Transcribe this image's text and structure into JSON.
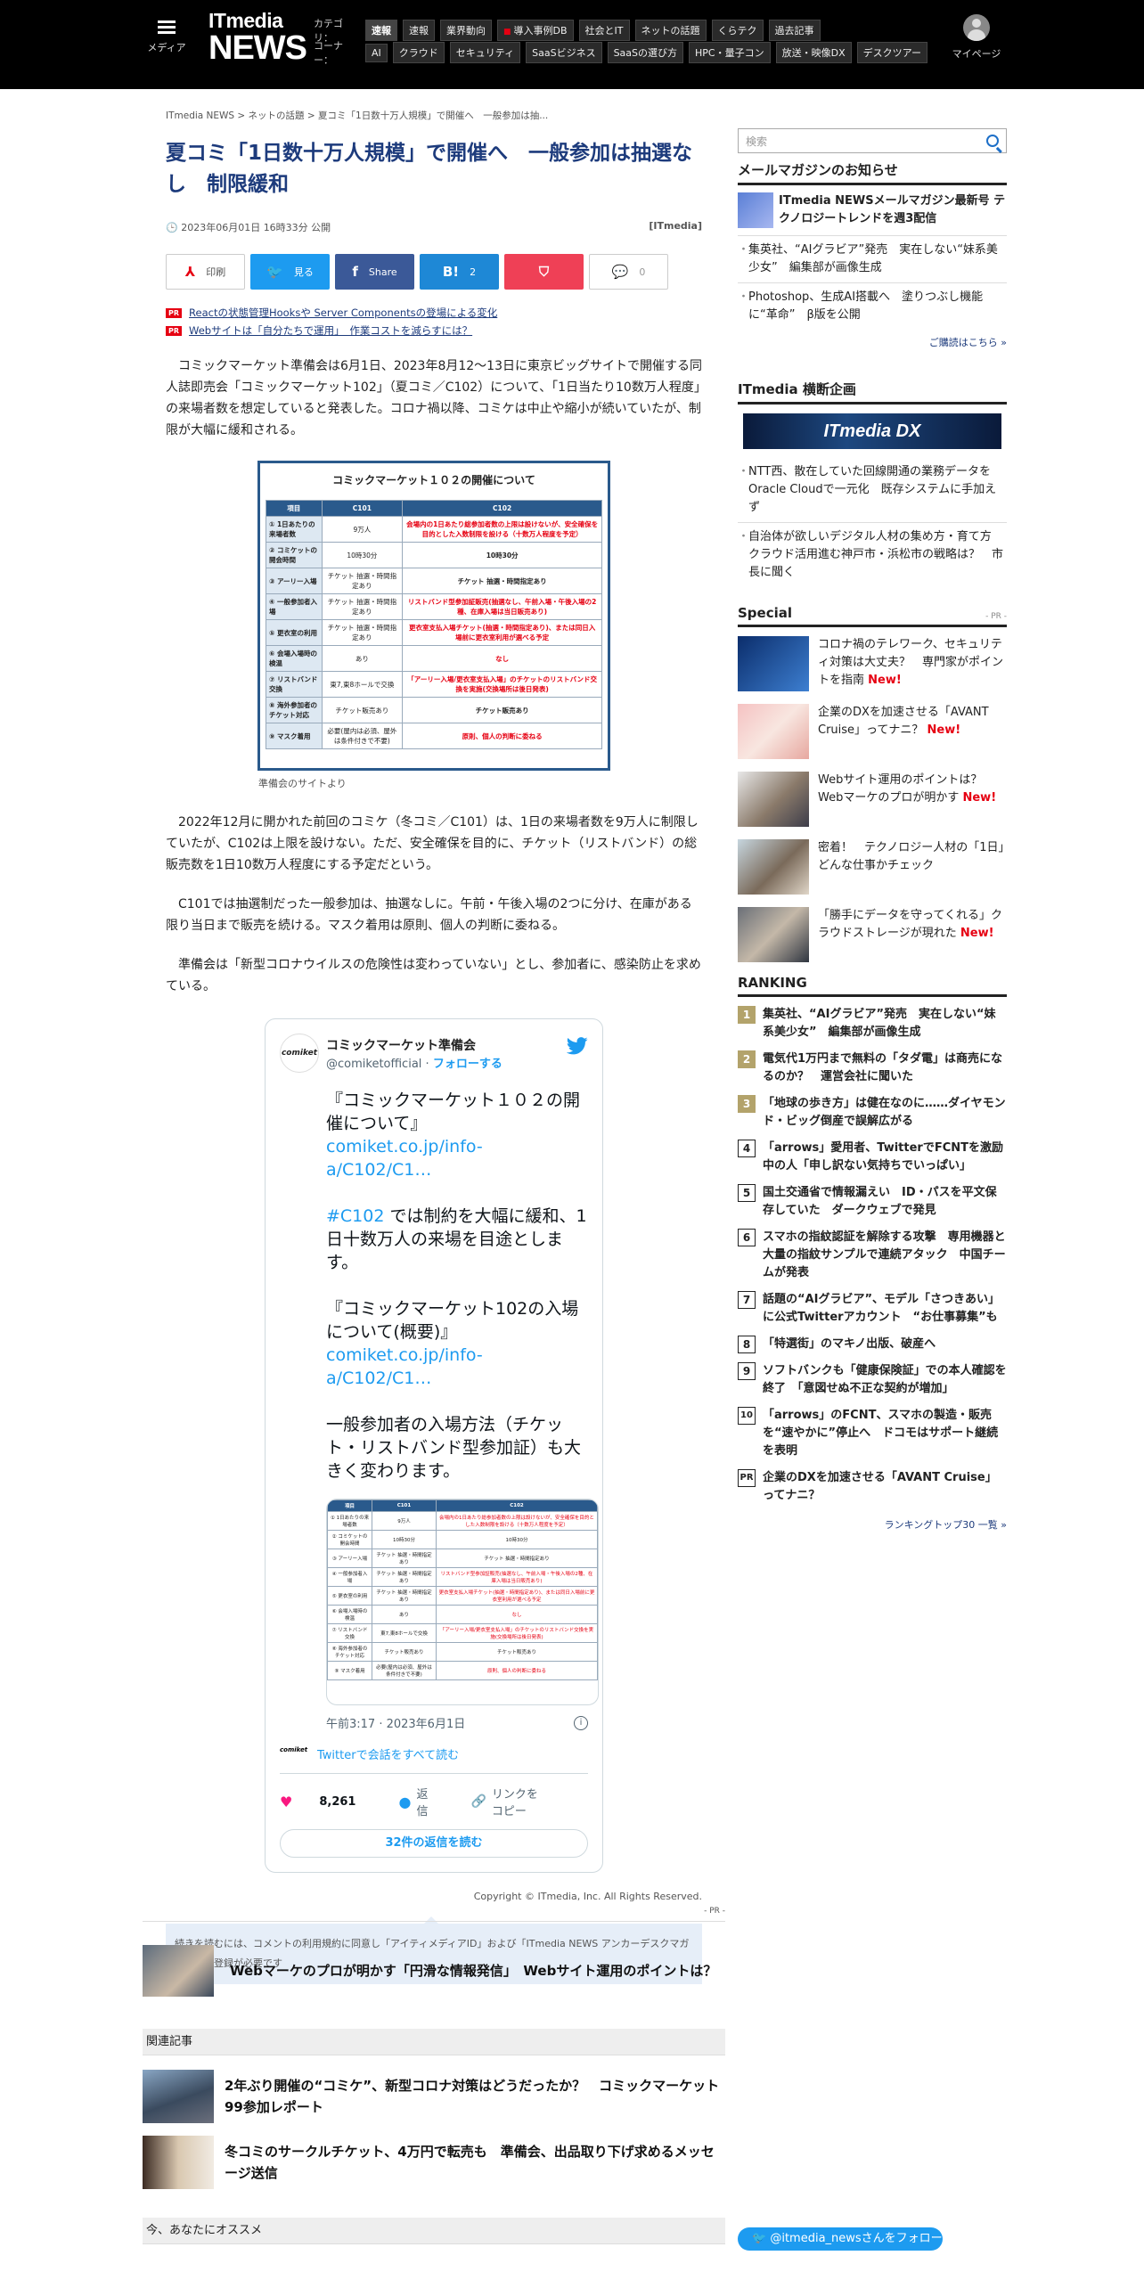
{
  "header": {
    "menu_label": "メディア",
    "logo_itmedia": "ITmedia",
    "logo_news": "NEWS",
    "category_label": "カテゴリ：",
    "categories": [
      "速報",
      "速報",
      "業界動向",
      "導入事例DB",
      "社会とIT",
      "ネットの話題",
      "くらテク",
      "過去記事"
    ],
    "corner_label": "コーナー：",
    "corners": [
      "AI",
      "クラウド",
      "セキュリティ",
      "SaaSビジネス",
      "SaaSの選び方",
      "HPC・量子コン",
      "放送・映像DX",
      "デスクツアー"
    ],
    "mypage_label": "マイページ"
  },
  "article": {
    "breadcrumb": "ITmedia NEWS > ネットの話題 > 夏コミ「1日数十万人規模」で開催へ　一般参加は抽...",
    "title": "夏コミ「1日数十万人規模」で開催へ　一般参加は抽選なし　制限緩和",
    "date": "2023年06月01日 16時33分 公開",
    "source": "[ITmedia]",
    "share": {
      "print": "印刷",
      "twitter": "見る",
      "facebook": "Share",
      "hatena": "2",
      "pocket": "",
      "comment": "0"
    },
    "pr_links": [
      "Reactの状態管理Hooksや Server Componentsの登場による変化",
      "Webサイトは「自分たちで運用」　作業コストを減らすには？"
    ],
    "paragraphs": [
      "コミックマーケット準備会は6月1日、2023年8月12～13日に東京ビッグサイトで開催する同人誌即売会「コミックマーケット102」（夏コミ／C102）について、「1日当たり10数万人程度」の来場者数を想定していると発表した。コロナ禍以降、コミケは中止や縮小が続いていたが、制限が大幅に緩和される。",
      "2022年12月に開かれた前回のコミケ（冬コミ／C101）は、1日の来場者数を9万人に制限していたが、C102は上限を設けない。ただ、安全確保を目的に、チケット（リストバンド）の総販売数を1日10数万人程度にする予定だという。",
      "C101では抽選制だった一般参加は、抽選なしに。午前・午後入場の2つに分け、在庫がある限り当日まで販売を続ける。マスク着用は原則、個人の判断に委ねる。",
      "準備会は「新型コロナウイルスの危険性は変わっていない」とし、参加者に、感染防止を求めている。"
    ],
    "figure": {
      "title": "コミックマーケット１０２の開催について",
      "headers": [
        "項目",
        "C101",
        "C102"
      ],
      "rows": [
        [
          "① 1日あたりの来場者数",
          "9万人",
          "会場内の1日あたり総参加者数の上限は設けないが、安全確保を目的とした入数制限を設ける（十数万人程度を予定）"
        ],
        [
          "② コミケットの開会時間",
          "10時30分",
          "10時30分"
        ],
        [
          "③ アーリー入場",
          "チケット 抽選・時間指定あり",
          "チケット 抽選・時間指定あり"
        ],
        [
          "④ 一般参加者入場",
          "チケット 抽選・時間指定あり",
          "リストバンド型参加証販売(抽選なし、午前入場・午後入場の2種、在庫入場は当日販売あり)"
        ],
        [
          "⑤ 更衣室の利用",
          "チケット 抽選・時間指定あり",
          "更衣室支払入場チケット(抽選・時間指定あり)、または同日入場前に更衣室利用が選べる予定"
        ],
        [
          "⑥ 会場入場時の検温",
          "あり",
          "なし"
        ],
        [
          "⑦ リストバンド交換",
          "東7,東8ホールで交換",
          "「アーリー入場/更衣室支払入場」のチケットのリストバンド交換を実施(交換場所は後日発表)"
        ],
        [
          "⑧ 海外参加者のチケット対応",
          "チケット販売あり",
          "チケット販売あり"
        ],
        [
          "⑨ マスク着用",
          "必要(屋内は必須、屋外は条件付きで不要)",
          "原則、個人の判断に委ねる"
        ]
      ],
      "caption": "準備会のサイトより"
    },
    "tweet": {
      "avatar_text": "comiket",
      "name": "コミックマーケット準備会",
      "handle": "@comiketofficial",
      "follow": "フォローする",
      "text1": "『コミックマーケット１０２の開催について』",
      "link1": "comiket.co.jp/info-a/C102/C1…",
      "hashtag": "#C102",
      "text2": " では制約を大幅に緩和、1日十数万人の来場を目途とします。",
      "text3": "『コミックマーケット102の入場について(概要)』",
      "link2": "comiket.co.jp/info-a/C102/C1…",
      "text4": "一般参加者の入場方法（チケット・リストバンド型参加証）も大きく変わります。",
      "time": "午前3:17 · 2023年6月1日",
      "conversation": "Twitterで会話をすべて読む",
      "likes": "8,261",
      "reply": "返信",
      "copy_link": "リンクをコピー",
      "read_replies": "32件の返信を読む"
    },
    "copyright": "Copyright © ITmedia, Inc. All Rights Reserved.",
    "notice": "続きを読むには、コメントの利用規約に同意し「アイティメディアID」および「ITmedia NEWS アンカーデスクマガジン」の登録が必要です"
  },
  "below": {
    "pr_tag": "- PR -",
    "pr_item": "Webマーケのプロが明かす「円滑な情報発信」　Webサイト運用のポイントは？",
    "related_heading": "関連記事",
    "related": [
      "2年ぶり開催の“コミケ”、新型コロナ対策はどうだったか？　コミックマーケット99参加レポート",
      "冬コミのサークルチケット、4万円で転売も　準備会、出品取り下げ求めるメッセージ送信"
    ],
    "recommend_heading": "今、あなたにオススメ"
  },
  "sidebar": {
    "search_placeholder": "検索",
    "mail_heading": "メールマガジンのお知らせ",
    "mail_title": "ITmedia NEWSメールマガジン最新号 テクノロジートレンドを週3配信",
    "mail_items": [
      "集英社、“AIグラビア”発売　実在しない“妹系美少女”　編集部が画像生成",
      "Photoshop、生成AI搭載へ　塗りつぶし機能に“革命”　β版を公開"
    ],
    "subscribe": "ご購読はこちら »",
    "cross_heading": "ITmedia 横断企画",
    "dx_banner": "ITmedia DX",
    "cross_items": [
      "NTT西、散在していた回線開通の業務データをOracle Cloudで一元化　既存システムに手加えず",
      "自治体が欲しいデジタル人材の集め方・育て方　クラウド活用進む神戸市・浜松市の戦略は？　市長に聞く"
    ],
    "special_heading": "Special",
    "special_pr": "- PR -",
    "special": [
      {
        "text": "コロナ禍のテレワーク、セキュリティ対策は大丈夫？　専門家がポイントを指南",
        "new": "New!"
      },
      {
        "text": "企業のDXを加速させる「AVANT Cruise」ってナニ？",
        "new": "New!"
      },
      {
        "text": "Webサイト運用のポイントは？　Webマーケのプロが明かす",
        "new": "New!"
      },
      {
        "text": "密着！　テクノロジー人材の「1日」　どんな仕事かチェック",
        "new": ""
      },
      {
        "text": "「勝手にデータを守ってくれる」クラウドストレージが現れた",
        "new": "New!"
      }
    ],
    "ranking_heading": "RANKING",
    "ranking": [
      {
        "n": "1",
        "text": "集英社、“AIグラビア”発売　実在しない“妹系美少女”　編集部が画像生成"
      },
      {
        "n": "2",
        "text": "電気代1万円まで無料の「タダ電」は商売になるのか？　運営会社に聞いた"
      },
      {
        "n": "3",
        "text": "「地球の歩き方」は健在なのに……ダイヤモンド・ビッグ倒産で誤解広がる"
      },
      {
        "n": "4",
        "text": "「arrows」愛用者、TwitterでFCNTを激励　中の人「申し訳ない気持ちでいっぱい」"
      },
      {
        "n": "5",
        "text": "国土交通省で情報漏えい　ID・パスを平文保存していた　ダークウェブで発見"
      },
      {
        "n": "6",
        "text": "スマホの指紋認証を解除する攻撃　専用機器と大量の指紋サンプルで連続アタック　中国チームが発表"
      },
      {
        "n": "7",
        "text": "話題の“AIグラビア”、モデル「さつきあい」に公式Twitterアカウント　“お仕事募集”も"
      },
      {
        "n": "8",
        "text": "「特選街」のマキノ出版、破産へ"
      },
      {
        "n": "9",
        "text": "ソフトバンクも「健康保険証」での本人確認を終了　「意図せぬ不正な契約が増加」"
      },
      {
        "n": "10",
        "text": "「arrows」のFCNT、スマホの製造・販売を“速やかに”停止へ　ドコモはサポート継続を表明"
      },
      {
        "n": "PR",
        "text": "企業のDXを加速させる「AVANT Cruise」ってナニ？"
      }
    ],
    "ranking_more": "ランキングトップ30 一覧 »",
    "follow": "@itmedia_newsさんをフォロー"
  }
}
